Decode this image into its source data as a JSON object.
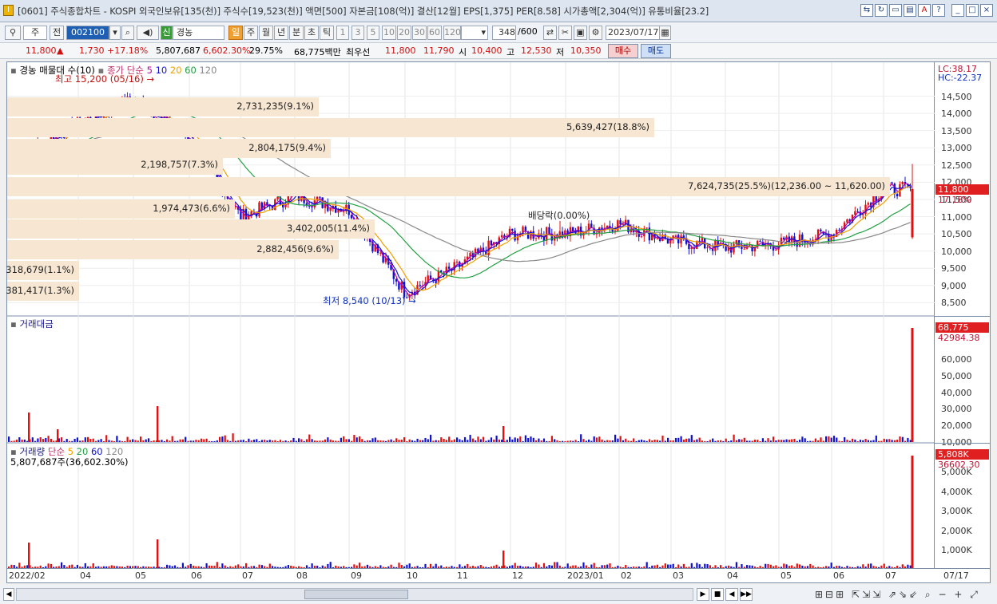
{
  "window": {
    "title": "[0601] 주식종합차트 - KOSPI 외국인보유[135(천)] 주식수[19,523(천)] 액면[500] 자본금[108(억)] 결산[12월] EPS[1,375] PER[8.58] 시가총액[2,304(억)] 유통비율[23.2]",
    "buttons": [
      "min",
      "max",
      "close"
    ]
  },
  "toolbar": {
    "market": "주",
    "scope": "전",
    "code": "002100",
    "stock_flag": "신",
    "stock_name": "경농",
    "periods": [
      "일",
      "주",
      "월",
      "년",
      "분",
      "초",
      "틱"
    ],
    "active_period": "일",
    "intervals": [
      "1",
      "3",
      "5",
      "10",
      "20",
      "30",
      "60",
      "120"
    ],
    "count_value": "348",
    "count_max": "/600",
    "date": "2023/07/17"
  },
  "info": {
    "price": "11,800",
    "arrow": "▲",
    "change": "1,730",
    "change_pct": "+17.18%",
    "volume": "5,807,687",
    "volume_pct": "6,602.30%",
    "turnover": "29.75%",
    "amount": "68,775백만",
    "bid_label": "최우선",
    "ask_price": "11,800",
    "bid_price": "11,790",
    "open_label": "시",
    "open": "10,400",
    "high_label": "고",
    "high": "12,530",
    "low_label": "저",
    "low": "10,350",
    "buy_label": "매수",
    "sell_label": "매도"
  },
  "price_panel": {
    "legend": {
      "title": "경농 매물대 수(10)",
      "ma_label": "종가 단순",
      "ma_periods": [
        "5",
        "10",
        "20",
        "60",
        "120"
      ],
      "ma_colors": [
        "#b000b0",
        "#1010d0",
        "#f0a000",
        "#20a040",
        "#888888"
      ]
    },
    "lc": "LC:38.17",
    "hc": "HC:-22.37",
    "max_note": "최고 15,200 (05/16)",
    "min_note": "최저 8,540 (10/13)",
    "dividend_note": "배당락(0.00%)",
    "current_price": "11,800",
    "current_pct": "17.18%",
    "y_ticks": [
      "14,500",
      "14,000",
      "13,500",
      "13,000",
      "12,500",
      "12,000",
      "11,500",
      "11,000",
      "10,500",
      "10,000",
      "9,500",
      "9,000",
      "8,500"
    ],
    "bands": [
      "2,731,235(9.1%)",
      "5,639,427(18.8%)",
      "2,804,175(9.4%)",
      "2,198,757(7.3%)",
      "7,624,735(25.5%)(12,236.00 ~ 11,620.00)",
      "1,974,473(6.6%)",
      "3,402,005(11.4%)",
      "2,882,456(9.6%)",
      "318,679(1.1%)",
      "381,417(1.3%)"
    ]
  },
  "amount_panel": {
    "title": "거래대금",
    "current": "68,775",
    "ma_value": "42984.38",
    "y_ticks": [
      "60,000",
      "50,000",
      "40,000",
      "30,000",
      "20,000",
      "10,000"
    ]
  },
  "volume_panel": {
    "title": "거래량",
    "ma_label": "단순",
    "ma_periods": [
      "5",
      "20",
      "60",
      "120"
    ],
    "sub": "5,807,687주(36,602.30%)",
    "current": "5,808K",
    "ma_value": "36602.30",
    "y_ticks": [
      "5,000K",
      "4,000K",
      "3,000K",
      "2,000K",
      "1,000K"
    ]
  },
  "x_axis": {
    "labels": [
      "2022/02",
      "04",
      "05",
      "06",
      "07",
      "08",
      "09",
      "10",
      "11",
      "12",
      "2023/01",
      "02",
      "03",
      "04",
      "05",
      "06",
      "07"
    ],
    "right_label": "07/17"
  },
  "status": {
    "buttons": [
      "▶",
      "■",
      "◀",
      "▶▶"
    ]
  },
  "chart_data": {
    "type": "candlestick",
    "title": "경농",
    "x": [
      "2022/02",
      "2022/04",
      "2022/05",
      "2022/06",
      "2022/07",
      "2022/08",
      "2022/09",
      "2022/10",
      "2022/11",
      "2022/12",
      "2023/01",
      "2023/02",
      "2023/03",
      "2023/04",
      "2023/05",
      "2023/06",
      "2023/07/17"
    ],
    "close": [
      12600,
      13700,
      14400,
      13300,
      11000,
      11600,
      11200,
      8800,
      9500,
      10500,
      10500,
      10800,
      10300,
      10100,
      10200,
      10500,
      11800
    ],
    "ylim": [
      8300,
      15300
    ],
    "max": {
      "value": 15200,
      "date": "05/16"
    },
    "min": {
      "value": 8540,
      "date": "10/13"
    }
  }
}
